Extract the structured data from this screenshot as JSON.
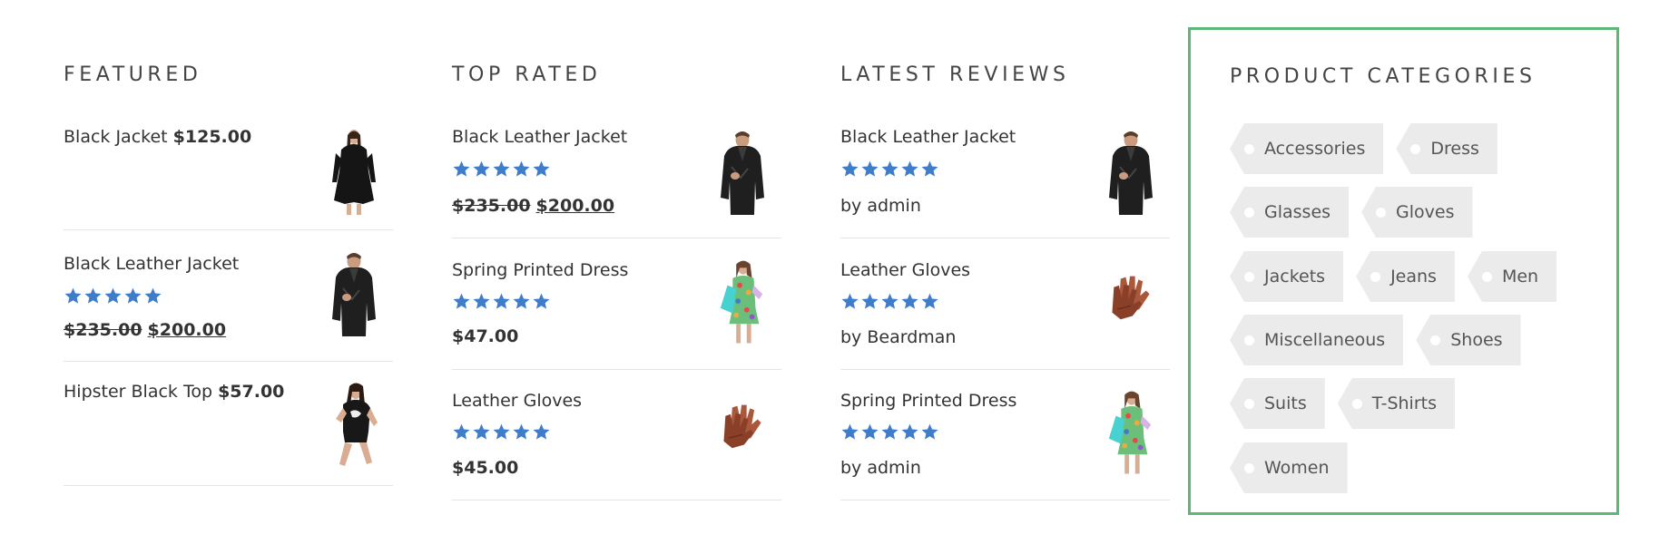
{
  "colors": {
    "star": "#3f7cc9",
    "category_border": "#5cb874",
    "tag_bg": "#ebebeb",
    "text": "#333333"
  },
  "featured": {
    "title": "FEATURED",
    "items": [
      {
        "name": "Black Jacket",
        "price": "$125.00",
        "thumb": "woman-black-jacket"
      },
      {
        "name": "Black Leather Jacket",
        "rating_stars": 5,
        "old_price": "$235.00",
        "new_price": "$200.00",
        "thumb": "man-leather-jacket"
      },
      {
        "name": "Hipster Black Top",
        "price": "$57.00",
        "thumb": "woman-black-top"
      }
    ]
  },
  "top_rated": {
    "title": "TOP RATED",
    "items": [
      {
        "name": "Black Leather Jacket",
        "rating_stars": 5,
        "old_price": "$235.00",
        "new_price": "$200.00",
        "thumb": "man-leather-jacket"
      },
      {
        "name": "Spring Printed Dress",
        "rating_stars": 5,
        "price": "$47.00",
        "thumb": "printed-dress"
      },
      {
        "name": "Leather Gloves",
        "rating_stars": 5,
        "price": "$45.00",
        "thumb": "leather-gloves"
      }
    ]
  },
  "latest_reviews": {
    "title": "LATEST REVIEWS",
    "items": [
      {
        "name": "Black Leather Jacket",
        "rating_stars": 5,
        "byline": "by admin",
        "thumb": "man-leather-jacket"
      },
      {
        "name": "Leather Gloves",
        "rating_stars": 5,
        "byline": "by Beardman",
        "thumb": "leather-gloves"
      },
      {
        "name": "Spring Printed Dress",
        "rating_stars": 5,
        "byline": "by admin",
        "thumb": "printed-dress"
      }
    ]
  },
  "categories": {
    "title": "PRODUCT CATEGORIES",
    "tags": [
      "Accessories",
      "Dress",
      "Glasses",
      "Gloves",
      "Jackets",
      "Jeans",
      "Men",
      "Miscellaneous",
      "Shoes",
      "Suits",
      "T-Shirts",
      "Women"
    ]
  }
}
